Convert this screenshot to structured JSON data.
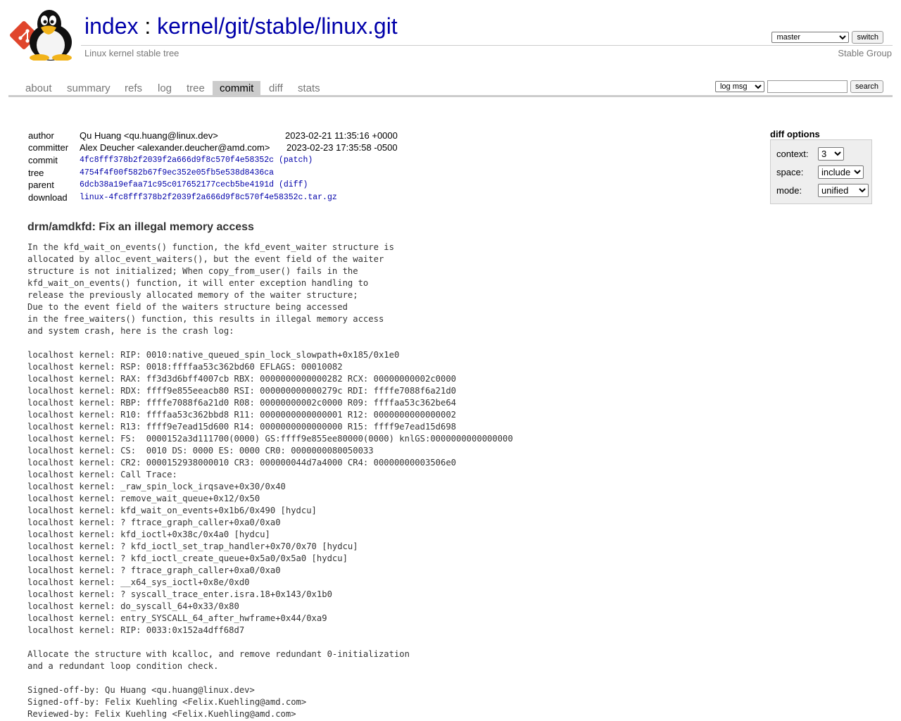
{
  "header": {
    "title_prefix": "index",
    "title_sep": " : ",
    "repo_path": "kernel/git/stable/linux.git",
    "description": "Linux kernel stable tree",
    "owner": "Stable Group",
    "branch_selected": "master",
    "switch_label": "switch"
  },
  "tabs": [
    "about",
    "summary",
    "refs",
    "log",
    "tree",
    "commit",
    "diff",
    "stats"
  ],
  "active_tab": "commit",
  "search": {
    "mode_selected": "log msg",
    "value": "",
    "button_label": "search"
  },
  "diff_options": {
    "title": "diff options",
    "context_label": "context:",
    "context_value": "3",
    "space_label": "space:",
    "space_value": "include",
    "mode_label": "mode:",
    "mode_value": "unified"
  },
  "commit_info": {
    "author_label": "author",
    "author": "Qu Huang <qu.huang@linux.dev>",
    "author_date": "2023-02-21 11:35:16 +0000",
    "committer_label": "committer",
    "committer": "Alex Deucher <alexander.deucher@amd.com>",
    "committer_date": "2023-02-23 17:35:58 -0500",
    "commit_label": "commit",
    "commit_hash": "4fc8fff378b2f2039f2a666d9f8c570f4e58352c",
    "patch_link": "(patch)",
    "tree_label": "tree",
    "tree_hash": "4754f4f00f582b67f9ec352e05fb5e538d8436ca",
    "parent_label": "parent",
    "parent_hash": "6dcb38a19efaa71c95c017652177cecb5be4191d",
    "diff_link": "(diff)",
    "download_label": "download",
    "download_file": "linux-4fc8fff378b2f2039f2a666d9f8c570f4e58352c.tar.gz"
  },
  "subject": "drm/amdkfd: Fix an illegal memory access",
  "message_lines": [
    "In the kfd_wait_on_events() function, the kfd_event_waiter structure is",
    "allocated by alloc_event_waiters(), but the event field of the waiter",
    "structure is not initialized; When copy_from_user() fails in the",
    "kfd_wait_on_events() function, it will enter exception handling to",
    "release the previously allocated memory of the waiter structure;",
    "Due to the event field of the waiters structure being accessed",
    "in the free_waiters() function, this results in illegal memory access",
    "and system crash, here is the crash log:",
    "",
    "localhost kernel: RIP: 0010:native_queued_spin_lock_slowpath+0x185/0x1e0",
    "localhost kernel: RSP: 0018:ffffaa53c362bd60 EFLAGS: 00010082",
    "localhost kernel: RAX: ff3d3d6bff4007cb RBX: 0000000000000282 RCX: 00000000002c0000",
    "localhost kernel: RDX: ffff9e855eeacb80 RSI: 000000000000279c RDI: ffffe7088f6a21d0",
    "localhost kernel: RBP: ffffe7088f6a21d0 R08: 00000000002c0000 R09: ffffaa53c362be64",
    "localhost kernel: R10: ffffaa53c362bbd8 R11: 0000000000000001 R12: 0000000000000002",
    "localhost kernel: R13: ffff9e7ead15d600 R14: 0000000000000000 R15: ffff9e7ead15d698",
    "localhost kernel: FS:  0000152a3d111700(0000) GS:ffff9e855ee80000(0000) knlGS:0000000000000000",
    "localhost kernel: CS:  0010 DS: 0000 ES: 0000 CR0: 0000000080050033",
    "localhost kernel: CR2: 0000152938000010 CR3: 000000044d7a4000 CR4: 00000000003506e0",
    "localhost kernel: Call Trace:",
    "localhost kernel: _raw_spin_lock_irqsave+0x30/0x40",
    "localhost kernel: remove_wait_queue+0x12/0x50",
    "localhost kernel: kfd_wait_on_events+0x1b6/0x490 [hydcu]",
    "localhost kernel: ? ftrace_graph_caller+0xa0/0xa0",
    "localhost kernel: kfd_ioctl+0x38c/0x4a0 [hydcu]",
    "localhost kernel: ? kfd_ioctl_set_trap_handler+0x70/0x70 [hydcu]",
    "localhost kernel: ? kfd_ioctl_create_queue+0x5a0/0x5a0 [hydcu]",
    "localhost kernel: ? ftrace_graph_caller+0xa0/0xa0",
    "localhost kernel: __x64_sys_ioctl+0x8e/0xd0",
    "localhost kernel: ? syscall_trace_enter.isra.18+0x143/0x1b0",
    "localhost kernel: do_syscall_64+0x33/0x80",
    "localhost kernel: entry_SYSCALL_64_after_hwframe+0x44/0xa9",
    "localhost kernel: RIP: 0033:0x152a4dff68d7",
    "",
    "Allocate the structure with kcalloc, and remove redundant 0-initialization",
    "and a redundant loop condition check.",
    "",
    "Signed-off-by: Qu Huang <qu.huang@linux.dev>",
    "Signed-off-by: Felix Kuehling <Felix.Kuehling@amd.com>",
    "Reviewed-by: Felix Kuehling <Felix.Kuehling@amd.com>"
  ]
}
